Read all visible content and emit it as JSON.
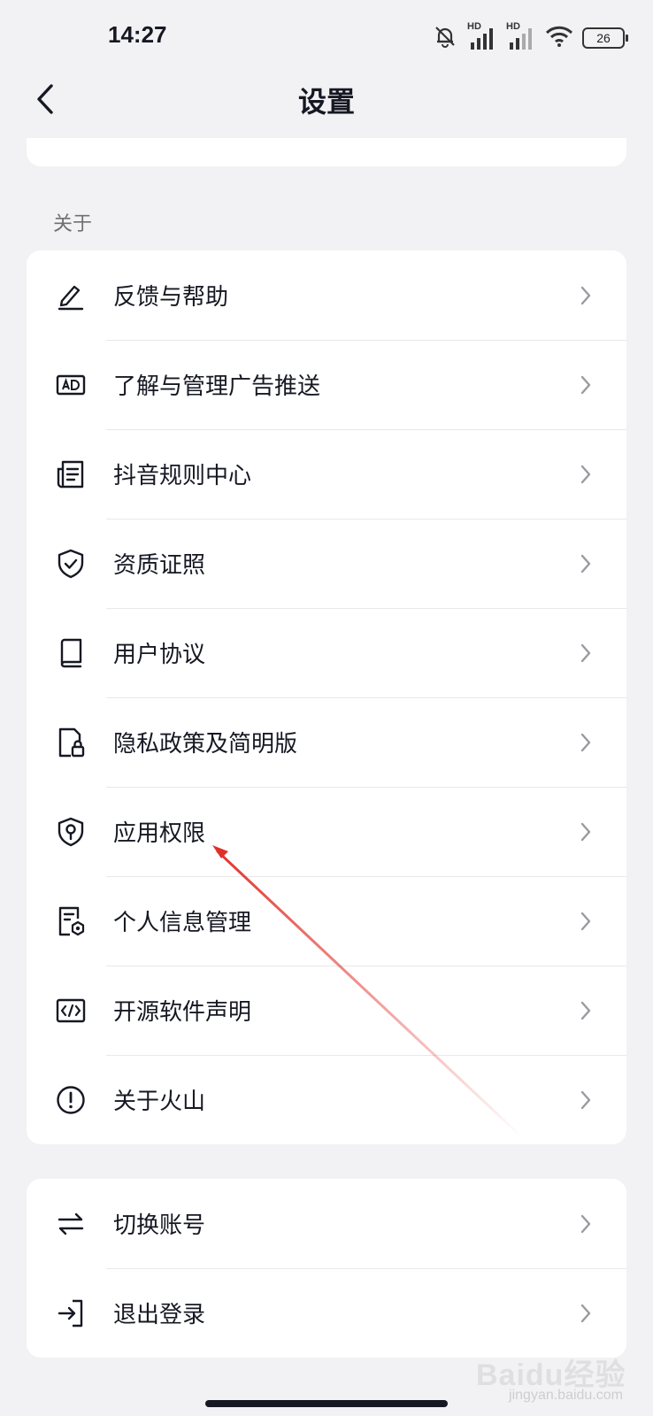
{
  "status_bar": {
    "time": "14:27",
    "net_label_1": "HD",
    "net_label_2": "HD",
    "battery": "26",
    "icons": [
      "mute-bell-icon",
      "signal-icon",
      "signal-icon",
      "wifi-icon",
      "battery-icon"
    ]
  },
  "navbar": {
    "title": "设置",
    "back_icon": "chevron-left-icon"
  },
  "about_section": {
    "label": "关于",
    "items": [
      {
        "label": "反馈与帮助",
        "icon": "edit-pen-icon"
      },
      {
        "label": "了解与管理广告推送",
        "icon": "ad-icon"
      },
      {
        "label": "抖音规则中心",
        "icon": "document-list-icon"
      },
      {
        "label": "资质证照",
        "icon": "shield-check-icon"
      },
      {
        "label": "用户协议",
        "icon": "book-icon"
      },
      {
        "label": "隐私政策及简明版",
        "icon": "privacy-lock-icon"
      },
      {
        "label": "应用权限",
        "icon": "permission-shield-icon"
      },
      {
        "label": "个人信息管理",
        "icon": "personal-info-icon"
      },
      {
        "label": "开源软件声明",
        "icon": "code-icon"
      },
      {
        "label": "关于火山",
        "icon": "info-exclamation-icon"
      }
    ]
  },
  "account_section": {
    "items": [
      {
        "label": "切换账号",
        "icon": "swap-arrows-icon"
      },
      {
        "label": "退出登录",
        "icon": "logout-icon"
      }
    ]
  },
  "watermark": {
    "logo": "Baidu经验",
    "site": "jingyan.baidu.com"
  },
  "colors": {
    "background": "#f2f2f4",
    "card": "#ffffff",
    "text": "#161823",
    "annotation_arrow": "#e0302a"
  }
}
